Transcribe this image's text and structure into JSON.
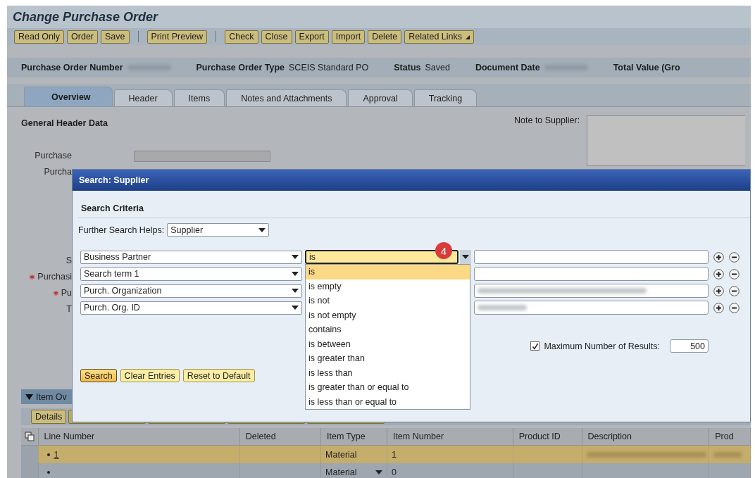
{
  "window": {
    "title": "Change Purchase Order"
  },
  "toolbar": [
    [
      {
        "label": "Read Only",
        "menu": false
      },
      {
        "label": "Order",
        "menu": false
      },
      {
        "label": "Save",
        "menu": false
      }
    ],
    [
      {
        "label": "Print Preview",
        "menu": false
      }
    ],
    [
      {
        "label": "Check",
        "menu": false
      },
      {
        "label": "Close",
        "menu": false
      },
      {
        "label": "Export",
        "menu": false
      },
      {
        "label": "Import",
        "menu": false
      },
      {
        "label": "Delete",
        "menu": false
      },
      {
        "label": "Related Links",
        "menu": true
      }
    ]
  ],
  "header_fields": [
    {
      "label": "Purchase Order Number",
      "kind": "redacted"
    },
    {
      "label": "Purchase Order Type",
      "kind": "text",
      "value": "SCEIS Standard PO"
    },
    {
      "label": "Status",
      "kind": "text",
      "value": "Saved"
    },
    {
      "label": "Document Date",
      "kind": "redacted"
    },
    {
      "label": "Total Value (Gro",
      "kind": "none"
    }
  ],
  "tabs": [
    {
      "label": "Overview",
      "selected": true
    },
    {
      "label": "Header",
      "selected": false
    },
    {
      "label": "Items",
      "selected": false
    },
    {
      "label": "Notes and Attachments",
      "selected": false
    },
    {
      "label": "Approval",
      "selected": false
    },
    {
      "label": "Tracking",
      "selected": false
    }
  ],
  "general": {
    "title": "General Header Data",
    "note_label": "Note to Supplier:",
    "labels": [
      {
        "text": "Purchase",
        "required": false
      },
      {
        "text": "Purcha",
        "required": false
      },
      {
        "text": "S",
        "required": false
      },
      {
        "text": "Purchasi",
        "required": true
      },
      {
        "text": "Pu",
        "required": true
      },
      {
        "text": "T",
        "required": false
      }
    ]
  },
  "dialog": {
    "title": "Search: Supplier",
    "section": "Search Criteria",
    "further_label": "Further Search Helps:",
    "further_value": "Supplier",
    "criteria": [
      {
        "attribute": "Business Partner",
        "operator": "is",
        "focused": true,
        "value_redacted": false
      },
      {
        "attribute": "Search term 1",
        "focused": false,
        "value_redacted": false
      },
      {
        "attribute": "Purch. Organization",
        "focused": false,
        "value_redacted": true
      },
      {
        "attribute": "Purch. Org. ID",
        "focused": false,
        "value_redacted": true
      }
    ],
    "badge": "4",
    "operator_options": [
      {
        "label": "is",
        "selected": true
      },
      {
        "label": "is empty",
        "selected": false
      },
      {
        "label": "is not",
        "selected": false
      },
      {
        "label": "is not empty",
        "selected": false
      },
      {
        "label": "contains",
        "selected": false
      },
      {
        "label": "is between",
        "selected": false
      },
      {
        "label": "is greater than",
        "selected": false
      },
      {
        "label": "is less than",
        "selected": false
      },
      {
        "label": "is greater than or equal to",
        "selected": false
      },
      {
        "label": "is less than or equal to",
        "selected": false
      }
    ],
    "max_results": {
      "checked": true,
      "label": "Maximum Number of Results:",
      "value": "500"
    },
    "buttons": [
      {
        "label": "Search",
        "primary": true
      },
      {
        "label": "Clear Entries",
        "primary": false
      },
      {
        "label": "Reset to Default",
        "primary": false
      }
    ]
  },
  "item_overview": {
    "title": "Item Ov",
    "buttons": [
      "Details"
    ],
    "columns": [
      "Line Number",
      "Deleted",
      "Item Type",
      "Item Number",
      "Product ID",
      "Description",
      "Prod"
    ],
    "rows": [
      {
        "line": "1",
        "item_type": "Material",
        "item_number": "1",
        "selected": true,
        "description_redacted": true
      },
      {
        "item_type": "Material",
        "item_number": "0",
        "selected": false,
        "description_redacted": false
      }
    ]
  }
}
